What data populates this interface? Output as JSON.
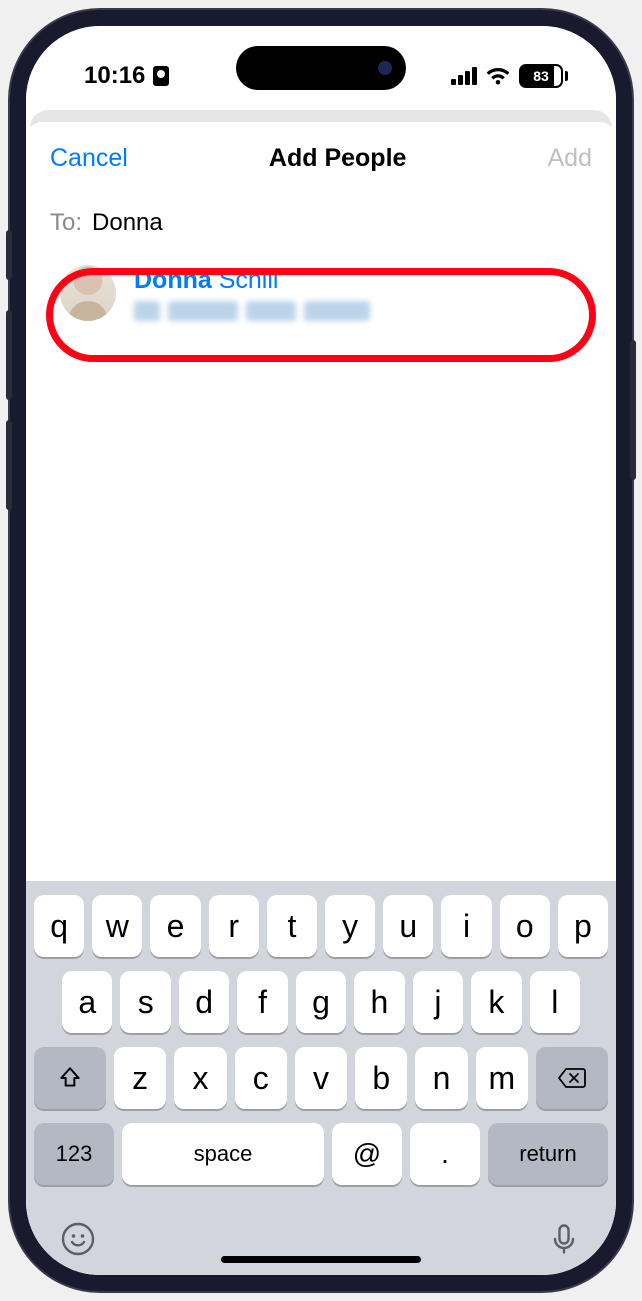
{
  "status": {
    "time": "10:16",
    "battery_pct": "83"
  },
  "nav": {
    "cancel": "Cancel",
    "title": "Add People",
    "add": "Add"
  },
  "to": {
    "label": "To:",
    "value": "Donna"
  },
  "result": {
    "name_match": "Donna",
    "name_rest": " Schill"
  },
  "keyboard": {
    "row1": [
      "q",
      "w",
      "e",
      "r",
      "t",
      "y",
      "u",
      "i",
      "o",
      "p"
    ],
    "row2": [
      "a",
      "s",
      "d",
      "f",
      "g",
      "h",
      "j",
      "k",
      "l"
    ],
    "row3": [
      "z",
      "x",
      "c",
      "v",
      "b",
      "n",
      "m"
    ],
    "num_key": "123",
    "space": "space",
    "at": "@",
    "dot": ".",
    "ret": "return"
  }
}
